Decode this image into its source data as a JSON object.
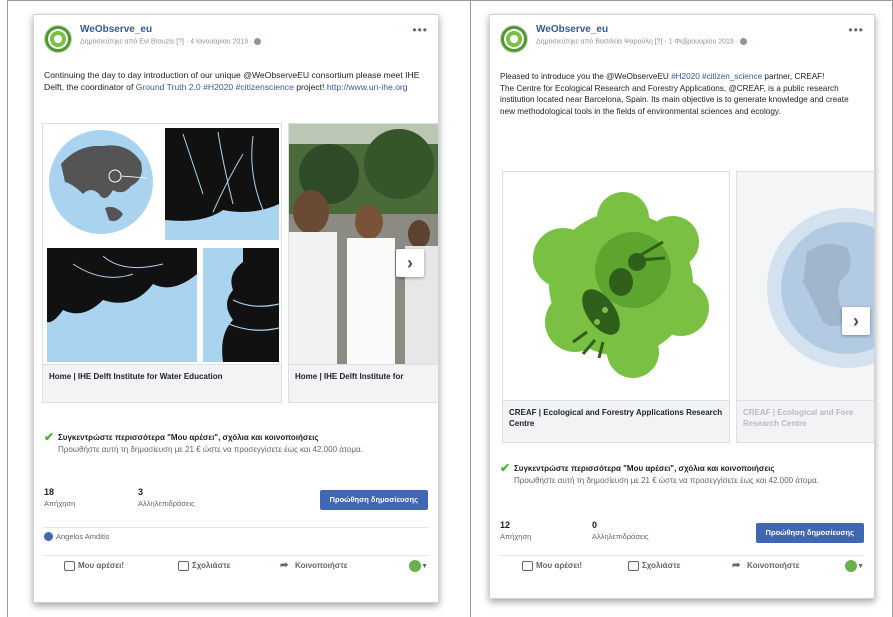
{
  "left_post": {
    "page_name": "WeObserve_eu",
    "meta": "Δημοσιεύτηκε από Evi Brouzis [?] · 4 Ιανουαρίου 2019 ·",
    "text_intro": "Continuing the day to day introduction of our unique @WeObserveEU consortium please meet IHE Delft, the coordinator of ",
    "text_link1": "Ground Truth 2.0",
    "text_tags": "#H2020 #citizenscience",
    "text_mid": " project! ",
    "text_url": "http://www.un-ihe.org",
    "slides": [
      {
        "caption": "Home | IHE Delft Institute for Water Education"
      },
      {
        "caption": "Home | IHE Delft Institute for"
      }
    ],
    "boost_title": "Συγκεντρώστε περισσότερα \"Μου αρέσει\", σχόλια και κοινοποιήσεις",
    "boost_desc": "Προωθήστε αυτή τη δημοσίευση με 21 € ώστε να προσεγγίσετε έως και 42.000 άτομα.",
    "reach_count": "18",
    "reach_label": "Απήχηση",
    "engage_count": "3",
    "engage_label": "Αλληλεπιδράσεις",
    "boost_button": "Προώθηση δημοσίευσης",
    "liked_by": "Angelos Amditis",
    "actions": {
      "like": "Μου αρέσει!",
      "comment": "Σχολιάστε",
      "share": "Κοινοποιήστε"
    }
  },
  "right_post": {
    "page_name": "WeObserve_eu",
    "meta": "Δημοσιεύτηκε από Βασιλεία Ψαρούλη [?] · 1 Φεβρουαρίου 2019 ·",
    "text_line1a": "Pleased to introduce you the @WeObserveEU ",
    "text_tags": "#H2020 #citizen_science",
    "text_line1b": " partner, CREAF!",
    "text_body": "The Centre for Ecological Research and Forestry Applications, @CREAF, is a public research institution located near Barcelona, Spain. Its main objective is to generate knowledge and create new methodological tools in the fields of environmental sciences and ecology.",
    "slides": [
      {
        "caption": "CREAF | Ecological and Forestry Applications Research Centre"
      },
      {
        "caption": "CREAF | Ecological and Fore Research Centre"
      }
    ],
    "boost_title": "Συγκεντρώστε περισσότερα \"Μου αρέσει\", σχόλια και κοινοποιήσεις",
    "boost_desc": "Προωθήστε αυτή τη δημοσίευση με 21 € ώστε να προσεγγίσετε έως και 42.000 άτομα.",
    "reach_count": "12",
    "reach_label": "Απήχηση",
    "engage_count": "0",
    "engage_label": "Αλληλεπιδράσεις",
    "boost_button": "Προώθηση δημοσίευσης",
    "actions": {
      "like": "Μου αρέσει!",
      "comment": "Σχολιάστε",
      "share": "Κοινοποιήστε"
    }
  },
  "colors": {
    "link": "#385898",
    "boost_button": "#4267b2",
    "check": "#42b72a",
    "creaf_green": "#6ab04c",
    "map_water": "#aad3f0"
  },
  "icons": [
    "more-dots-icon",
    "globe-icon",
    "next-arrow-icon",
    "check-icon",
    "like-icon",
    "comment-icon",
    "share-icon",
    "reaction-icon"
  ]
}
